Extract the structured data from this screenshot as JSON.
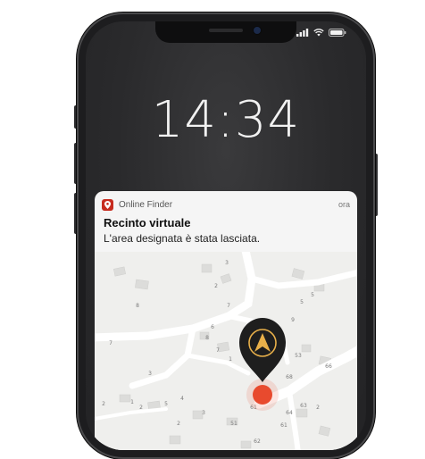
{
  "lock_screen": {
    "time": "14:34"
  },
  "notification": {
    "app_name": "Online Finder",
    "time_ago": "ora",
    "title": "Recinto virtuale",
    "body": "L'area designata è stata lasciata."
  },
  "map": {
    "labels": [
      "8",
      "7",
      "2",
      "3",
      "5",
      "7",
      "9",
      "5",
      "6",
      "8",
      "7",
      "1",
      "3",
      "4",
      "2",
      "5",
      "53",
      "68",
      "66",
      "1",
      "3",
      "2",
      "61",
      "64",
      "2",
      "63",
      "2",
      "61",
      "62",
      "51"
    ]
  },
  "colors": {
    "accent": "#e84a2e",
    "brand": "#c62b1e",
    "pin": "#1e1e1e",
    "pin_ring": "#e8b04a"
  }
}
